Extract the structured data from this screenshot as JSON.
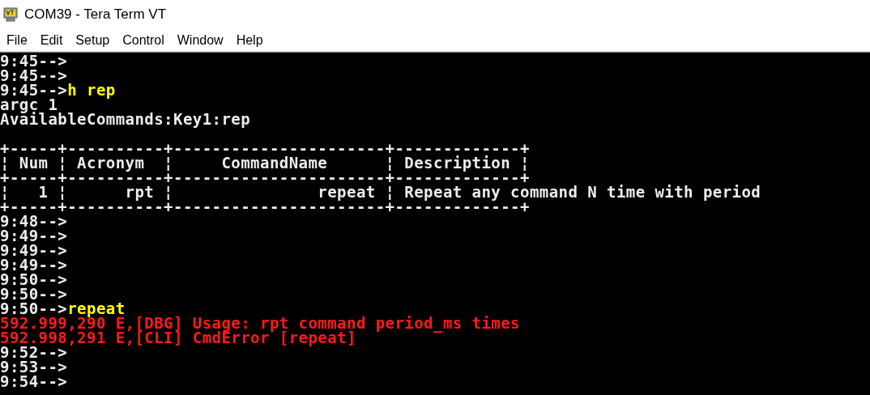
{
  "window": {
    "title": "COM39 - Tera Term VT"
  },
  "menu": [
    "File",
    "Edit",
    "Setup",
    "Control",
    "Window",
    "Help"
  ],
  "terminal": {
    "lines": [
      {
        "kind": "prompt",
        "prompt": "9:45-->"
      },
      {
        "kind": "prompt",
        "prompt": "9:45-->"
      },
      {
        "kind": "prompt",
        "prompt": "9:45-->",
        "command": "h rep"
      },
      {
        "kind": "output",
        "text": "argc 1"
      },
      {
        "kind": "output",
        "text": "AvailableCommands:Key1:rep"
      },
      {
        "kind": "blank"
      },
      {
        "kind": "output",
        "text": "+-----+----------+----------------------+-------------+"
      },
      {
        "kind": "output",
        "text": "¦ Num ¦ Acronym  ¦     CommandName      ¦ Description ¦"
      },
      {
        "kind": "output",
        "text": "+-----+----------+----------------------+-------------+"
      },
      {
        "kind": "output",
        "text": "¦   1 ¦      rpt ¦               repeat ¦ Repeat any command N time with period"
      },
      {
        "kind": "output",
        "text": "+-----+----------+----------------------+-------------+"
      },
      {
        "kind": "prompt",
        "prompt": "9:48-->"
      },
      {
        "kind": "prompt",
        "prompt": "9:49-->"
      },
      {
        "kind": "prompt",
        "prompt": "9:49-->"
      },
      {
        "kind": "prompt",
        "prompt": "9:49-->"
      },
      {
        "kind": "prompt",
        "prompt": "9:50-->"
      },
      {
        "kind": "prompt",
        "prompt": "9:50-->"
      },
      {
        "kind": "prompt",
        "prompt": "9:50-->",
        "command": "repeat"
      },
      {
        "kind": "error",
        "text": "592.999,290 E,[DBG] Usage: rpt command period_ms times"
      },
      {
        "kind": "error",
        "text": "592.998,291 E,[CLI] CmdError [repeat]"
      },
      {
        "kind": "prompt",
        "prompt": "9:52-->"
      },
      {
        "kind": "prompt",
        "prompt": "9:53-->"
      },
      {
        "kind": "prompt",
        "prompt": "9:54-->"
      }
    ]
  }
}
